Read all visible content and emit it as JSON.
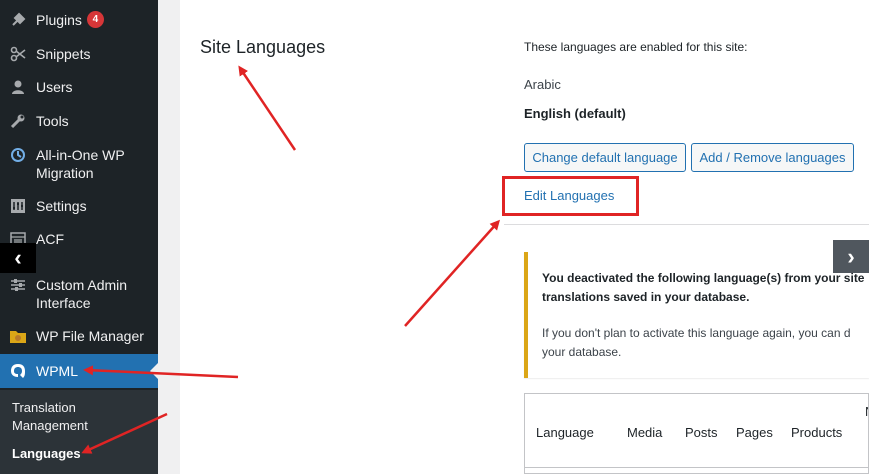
{
  "sidebar": {
    "items": [
      {
        "label": "Plugins",
        "badge": "4",
        "icon": "plugin-icon"
      },
      {
        "label": "Snippets",
        "icon": "scissors-icon"
      },
      {
        "label": "Users",
        "icon": "user-icon"
      },
      {
        "label": "Tools",
        "icon": "wrench-icon"
      },
      {
        "label": "All-in-One WP Migration",
        "icon": "migration-icon"
      },
      {
        "label": "Settings",
        "icon": "settings-icon"
      },
      {
        "label": "ACF",
        "icon": "acf-icon"
      },
      {
        "label": "Custom Admin Interface",
        "icon": "sliders-icon"
      },
      {
        "label": "WP File Manager",
        "icon": "file-manager-icon"
      },
      {
        "label": "WPML",
        "icon": "wpml-icon"
      }
    ],
    "submenu": [
      {
        "label": "Translation Management"
      },
      {
        "label": "Languages"
      }
    ]
  },
  "main": {
    "title": "Site Languages",
    "intro": "These languages are enabled for this site:",
    "languages": [
      "Arabic",
      "English (default)"
    ],
    "buttons": {
      "change_default": "Change default language",
      "add_remove": "Add / Remove languages"
    },
    "edit_link": "Edit Languages",
    "notice": {
      "bold_line1": "You deactivated the following language(s) from your site",
      "bold_line2": "translations saved in your database.",
      "body_line1": "If you don't plan to activate this language again, you can d",
      "body_line2": "your database."
    },
    "table": {
      "headers": [
        "Language",
        "Media",
        "Posts",
        "Pages",
        "Products"
      ],
      "cut_header": "N"
    }
  },
  "colors": {
    "sidebar_bg": "#1d2327",
    "active_blue": "#2271b1",
    "annotation_red": "#e02424",
    "notice_border": "#dba617"
  }
}
